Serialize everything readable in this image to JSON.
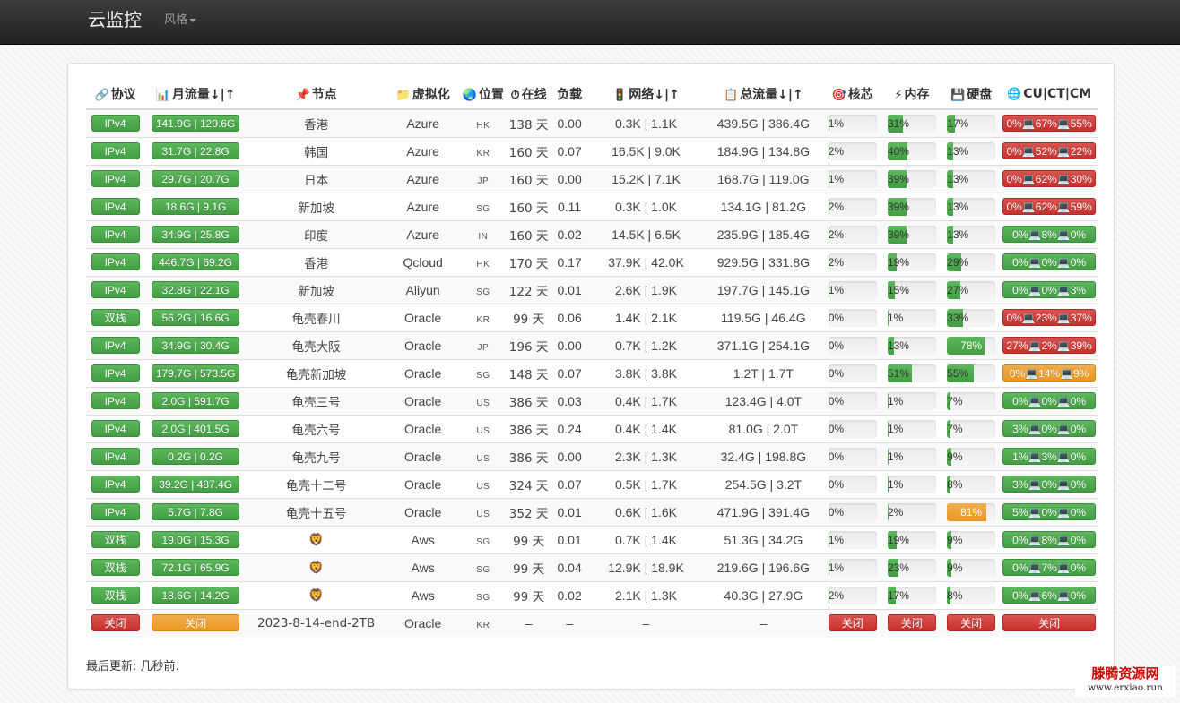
{
  "navbar": {
    "brand": "云监控",
    "style_menu": "风格"
  },
  "colors": {
    "green": "#5cb85c",
    "red": "#d9534f",
    "orange": "#f0ad4e",
    "navbar": "#222222"
  },
  "table": {
    "headers": [
      {
        "icon": "link-icon",
        "label": "协议"
      },
      {
        "icon": "bar-chart-icon",
        "label": "月流量↓|↑"
      },
      {
        "icon": "pin-icon",
        "label": "节点"
      },
      {
        "icon": "folder-icon",
        "label": "虚拟化"
      },
      {
        "icon": "globe-icon",
        "label": "位置"
      },
      {
        "icon": "stopwatch-icon",
        "label": "在线"
      },
      {
        "icon": "",
        "label": "负载"
      },
      {
        "icon": "traffic-light-icon",
        "label": "网络↓|↑"
      },
      {
        "icon": "clipboard-icon",
        "label": "总流量↓|↑"
      },
      {
        "icon": "target-icon",
        "label": "核芯"
      },
      {
        "icon": "lightning-icon",
        "label": "内存"
      },
      {
        "icon": "floppy-disk-icon",
        "label": "硬盘"
      },
      {
        "icon": "globe-network-icon",
        "label": "CU|CT|CM"
      }
    ],
    "rows": [
      {
        "proto": "IPv4",
        "month": "141.9G | 129.6G",
        "node": "香港",
        "node_icon": "",
        "virt": "Azure",
        "loc": "HK",
        "uptime": "138 天",
        "load": "0.00",
        "net": "0.3K | 1.1K",
        "total": "439.5G | 386.4G",
        "cpu": 1,
        "mem": 31,
        "hdd": 17,
        "isp": "0%💻67%💻55%",
        "isp_color": "red"
      },
      {
        "proto": "IPv4",
        "month": "31.7G | 22.8G",
        "node": "韩国",
        "node_icon": "",
        "virt": "Azure",
        "loc": "KR",
        "uptime": "160 天",
        "load": "0.07",
        "net": "16.5K | 9.0K",
        "total": "184.9G | 134.8G",
        "cpu": 2,
        "mem": 40,
        "hdd": 13,
        "isp": "0%💻52%💻22%",
        "isp_color": "red"
      },
      {
        "proto": "IPv4",
        "month": "29.7G | 20.7G",
        "node": "日本",
        "node_icon": "",
        "virt": "Azure",
        "loc": "JP",
        "uptime": "160 天",
        "load": "0.00",
        "net": "15.2K | 7.1K",
        "total": "168.7G | 119.0G",
        "cpu": 1,
        "mem": 39,
        "hdd": 13,
        "isp": "0%💻62%💻30%",
        "isp_color": "red"
      },
      {
        "proto": "IPv4",
        "month": "18.6G | 9.1G",
        "node": "新加坡",
        "node_icon": "",
        "virt": "Azure",
        "loc": "SG",
        "uptime": "160 天",
        "load": "0.11",
        "net": "0.3K | 1.0K",
        "total": "134.1G | 81.2G",
        "cpu": 2,
        "mem": 39,
        "hdd": 13,
        "isp": "0%💻62%💻59%",
        "isp_color": "red"
      },
      {
        "proto": "IPv4",
        "month": "34.9G | 25.8G",
        "node": "印度",
        "node_icon": "",
        "virt": "Azure",
        "loc": "IN",
        "uptime": "160 天",
        "load": "0.02",
        "net": "14.5K | 6.5K",
        "total": "235.9G | 185.4G",
        "cpu": 2,
        "mem": 39,
        "hdd": 13,
        "isp": "0%💻8%💻0%",
        "isp_color": "green"
      },
      {
        "proto": "IPv4",
        "month": "446.7G | 69.2G",
        "node": "香港",
        "node_icon": "",
        "virt": "Qcloud",
        "loc": "HK",
        "uptime": "170 天",
        "load": "0.17",
        "net": "37.9K | 42.0K",
        "total": "929.5G | 331.8G",
        "cpu": 2,
        "mem": 19,
        "hdd": 29,
        "isp": "0%💻0%💻0%",
        "isp_color": "green"
      },
      {
        "proto": "IPv4",
        "month": "32.8G | 22.1G",
        "node": "新加坡",
        "node_icon": "",
        "virt": "Aliyun",
        "loc": "SG",
        "uptime": "122 天",
        "load": "0.01",
        "net": "2.6K | 1.9K",
        "total": "197.7G | 145.1G",
        "cpu": 1,
        "mem": 15,
        "hdd": 27,
        "isp": "0%💻0%💻3%",
        "isp_color": "green"
      },
      {
        "proto": "双栈",
        "month": "56.2G | 16.6G",
        "node": "龟壳春川",
        "node_icon": "",
        "virt": "Oracle",
        "loc": "KR",
        "uptime": "99 天",
        "load": "0.06",
        "net": "1.4K | 2.1K",
        "total": "119.5G | 46.4G",
        "cpu": 0,
        "mem": 1,
        "hdd": 33,
        "isp": "0%💻23%💻37%",
        "isp_color": "red"
      },
      {
        "proto": "IPv4",
        "month": "34.9G | 30.4G",
        "node": "龟壳大阪",
        "node_icon": "",
        "virt": "Oracle",
        "loc": "JP",
        "uptime": "196 天",
        "load": "0.00",
        "net": "0.7K | 1.2K",
        "total": "371.1G | 254.1G",
        "cpu": 0,
        "mem": 13,
        "hdd": 78,
        "isp": "27%💻2%💻39%",
        "isp_color": "red"
      },
      {
        "proto": "IPv4",
        "month": "179.7G | 573.5G",
        "node": "龟壳新加坡",
        "node_icon": "",
        "virt": "Oracle",
        "loc": "SG",
        "uptime": "148 天",
        "load": "0.07",
        "net": "3.8K | 3.8K",
        "total": "1.2T | 1.7T",
        "cpu": 0,
        "mem": 51,
        "hdd": 55,
        "isp": "0%💻14%💻9%",
        "isp_color": "orange"
      },
      {
        "proto": "IPv4",
        "month": "2.0G | 591.7G",
        "node": "龟壳三号",
        "node_icon": "",
        "virt": "Oracle",
        "loc": "US",
        "uptime": "386 天",
        "load": "0.03",
        "net": "0.4K | 1.7K",
        "total": "123.4G | 4.0T",
        "cpu": 0,
        "mem": 1,
        "hdd": 7,
        "isp": "0%💻0%💻0%",
        "isp_color": "green"
      },
      {
        "proto": "IPv4",
        "month": "2.0G | 401.5G",
        "node": "龟壳六号",
        "node_icon": "",
        "virt": "Oracle",
        "loc": "US",
        "uptime": "386 天",
        "load": "0.24",
        "net": "0.4K | 1.4K",
        "total": "81.0G | 2.0T",
        "cpu": 0,
        "mem": 1,
        "hdd": 7,
        "isp": "3%💻0%💻0%",
        "isp_color": "green"
      },
      {
        "proto": "IPv4",
        "month": "0.2G | 0.2G",
        "node": "龟壳九号",
        "node_icon": "",
        "virt": "Oracle",
        "loc": "US",
        "uptime": "386 天",
        "load": "0.00",
        "net": "2.3K | 1.3K",
        "total": "32.4G | 198.8G",
        "cpu": 0,
        "mem": 1,
        "hdd": 9,
        "isp": "1%💻3%💻0%",
        "isp_color": "green"
      },
      {
        "proto": "IPv4",
        "month": "39.2G | 487.4G",
        "node": "龟壳十二号",
        "node_icon": "",
        "virt": "Oracle",
        "loc": "US",
        "uptime": "324 天",
        "load": "0.07",
        "net": "0.5K | 1.7K",
        "total": "254.5G | 3.2T",
        "cpu": 0,
        "mem": 1,
        "hdd": 8,
        "isp": "3%💻0%💻0%",
        "isp_color": "green"
      },
      {
        "proto": "IPv4",
        "month": "5.7G | 7.8G",
        "node": "龟壳十五号",
        "node_icon": "",
        "virt": "Oracle",
        "loc": "US",
        "uptime": "352 天",
        "load": "0.01",
        "net": "0.6K | 1.6K",
        "total": "471.9G | 391.4G",
        "cpu": 0,
        "mem": 2,
        "hdd": 81,
        "isp": "5%💻0%💻0%",
        "isp_color": "green"
      },
      {
        "proto": "双栈",
        "month": "19.0G | 15.3G",
        "node": "",
        "node_icon": "🦁",
        "virt": "Aws",
        "loc": "SG",
        "uptime": "99 天",
        "load": "0.01",
        "net": "0.7K | 1.4K",
        "total": "51.3G | 34.2G",
        "cpu": 1,
        "mem": 19,
        "hdd": 9,
        "isp": "0%💻8%💻0%",
        "isp_color": "green"
      },
      {
        "proto": "双栈",
        "month": "72.1G | 65.9G",
        "node": "",
        "node_icon": "🦁",
        "virt": "Aws",
        "loc": "SG",
        "uptime": "99 天",
        "load": "0.04",
        "net": "12.9K | 18.9K",
        "total": "219.6G | 196.6G",
        "cpu": 1,
        "mem": 23,
        "hdd": 9,
        "isp": "0%💻7%💻0%",
        "isp_color": "green"
      },
      {
        "proto": "双栈",
        "month": "18.6G | 14.2G",
        "node": "",
        "node_icon": "🦁",
        "virt": "Aws",
        "loc": "SG",
        "uptime": "99 天",
        "load": "0.02",
        "net": "2.1K | 1.3K",
        "total": "40.3G | 27.9G",
        "cpu": 2,
        "mem": 17,
        "hdd": 8,
        "isp": "0%💻6%💻0%",
        "isp_color": "green"
      }
    ],
    "offline_row": {
      "proto": "关闭",
      "month": "关闭",
      "node": "2023-8-14-end-2TB",
      "virt": "Oracle",
      "loc": "KR",
      "uptime": "–",
      "load": "–",
      "net": "–",
      "total": "–",
      "cpu": "关闭",
      "mem": "关闭",
      "hdd": "关闭",
      "isp": "关闭"
    }
  },
  "footer": {
    "last_update": "最后更新: 几秒前."
  },
  "watermark": {
    "title": "滕腾资源网",
    "url": "www.erxiao.run"
  }
}
